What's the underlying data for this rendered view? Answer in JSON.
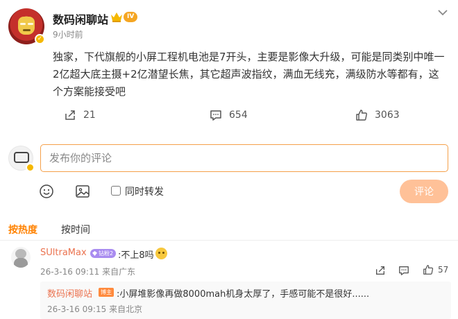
{
  "post": {
    "author": "数码闲聊站",
    "level": "IV",
    "time": "9小时前",
    "text": "独家，下代旗舰的小屏工程机电池是7开头，主要是影像大升级，可能是同类别中唯一2亿超大底主摄+2亿潜望长焦，其它超声波指纹，满血无线充，满级防水等都有，这个方案能接受吧",
    "reposts": "21",
    "comments": "654",
    "likes": "3063"
  },
  "composer": {
    "placeholder": "发布你的评论",
    "repost_label": "同时转发",
    "submit_label": "评论"
  },
  "sort_tabs": {
    "hot": "按热度",
    "time": "按时间"
  },
  "comments": [
    {
      "user": "SUltraMax",
      "badge": "钻粉2",
      "text": ":不上8吗",
      "date": "26-3-16 09:11",
      "location": "来自广东",
      "likes": "57",
      "replies": [
        {
          "user": "数码闲聊站",
          "badge": "博主",
          "text": ":小屏堆影像再做8000mah机身太厚了，手感可能不是很好......",
          "date": "26-3-16 09:15",
          "location": "来自北京"
        }
      ]
    }
  ],
  "colors": {
    "accent_orange": "#ff8200",
    "name_color": "#eb7350",
    "input_border": "#f5a04a",
    "submit_bg": "#ffc198",
    "gold": "#f5b800",
    "fan_badge": "#a98cf0"
  },
  "icons": [
    "crown-icon",
    "chevron-down-icon",
    "repost-icon",
    "comment-icon",
    "like-icon",
    "emoji-icon",
    "image-icon"
  ]
}
